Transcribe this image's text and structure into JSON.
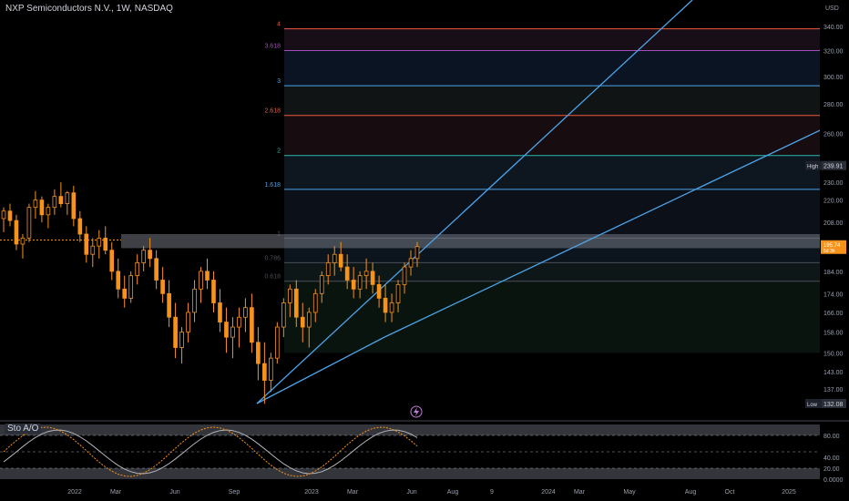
{
  "header": {
    "title": "NXP Semiconductors N.V., 1W, NASDAQ"
  },
  "currency": "USD",
  "indicator_label": "Sto A/O",
  "price_badges": {
    "high": {
      "label": "High",
      "value": "239.91"
    },
    "low": {
      "label": "Low",
      "value": "132.08"
    },
    "last": {
      "value": "195.74",
      "sub": "5d 3h"
    }
  },
  "colors": {
    "candle": "#f7931a",
    "trendline": "#4da3e8",
    "fib_0": "#4a4e59",
    "fib_1618": "#4da3e8",
    "fib_2": "#2bbcb0",
    "fib_2618": "#f05a3c",
    "fib_3": "#4da3e8",
    "fib_3618": "#a64dbf",
    "fib_4": "#f05a3c"
  },
  "chart_data": {
    "type": "candlestick",
    "timeframe": "1W",
    "y_axis_ticks": [
      "340.00",
      "320.00",
      "300.00",
      "280.00",
      "260.00",
      "240.00",
      "230.00",
      "220.00",
      "208.00",
      "196.00",
      "184.00",
      "174.00",
      "166.00",
      "158.00",
      "150.00",
      "143.00",
      "137.00"
    ],
    "y_axis_scale": "log",
    "x_axis_ticks": [
      "2022",
      "Mar",
      "Jun",
      "Sep",
      "2023",
      "Mar",
      "Jun",
      "Aug",
      "9",
      "2024",
      "Mar",
      "May",
      "Aug",
      "Oct",
      "2025"
    ],
    "fib_levels": [
      {
        "label": "0.618",
        "price": 179.5
      },
      {
        "label": "0.786",
        "price": 188
      },
      {
        "label": "1",
        "price": 200
      },
      {
        "label": "1.618",
        "price": 226
      },
      {
        "label": "2",
        "price": 246
      },
      {
        "label": "2.618",
        "price": 272
      },
      {
        "label": "3",
        "price": 293
      },
      {
        "label": "3.618",
        "price": 320
      },
      {
        "label": "4",
        "price": 338
      }
    ],
    "candles": [
      [
        210,
        216,
        203,
        214
      ],
      [
        214,
        218,
        206,
        209
      ],
      [
        209,
        212,
        194,
        197
      ],
      [
        197,
        202,
        190,
        200
      ],
      [
        200,
        218,
        198,
        216
      ],
      [
        216,
        225,
        210,
        220
      ],
      [
        220,
        222,
        208,
        212
      ],
      [
        212,
        218,
        205,
        216
      ],
      [
        216,
        226,
        212,
        222
      ],
      [
        222,
        230,
        216,
        218
      ],
      [
        218,
        225,
        212,
        224
      ],
      [
        224,
        228,
        206,
        210
      ],
      [
        210,
        214,
        198,
        202
      ],
      [
        202,
        206,
        188,
        192
      ],
      [
        192,
        200,
        186,
        196
      ],
      [
        196,
        204,
        190,
        200
      ],
      [
        200,
        206,
        192,
        194
      ],
      [
        194,
        198,
        180,
        184
      ],
      [
        184,
        190,
        172,
        176
      ],
      [
        176,
        182,
        168,
        172
      ],
      [
        172,
        184,
        170,
        182
      ],
      [
        182,
        192,
        178,
        188
      ],
      [
        188,
        196,
        184,
        194
      ],
      [
        194,
        200,
        186,
        190
      ],
      [
        190,
        194,
        176,
        180
      ],
      [
        180,
        186,
        170,
        174
      ],
      [
        174,
        180,
        160,
        164
      ],
      [
        164,
        170,
        148,
        152
      ],
      [
        152,
        160,
        146,
        158
      ],
      [
        158,
        170,
        154,
        166
      ],
      [
        166,
        180,
        162,
        176
      ],
      [
        176,
        186,
        170,
        184
      ],
      [
        184,
        190,
        176,
        180
      ],
      [
        180,
        184,
        166,
        170
      ],
      [
        170,
        176,
        158,
        162
      ],
      [
        162,
        168,
        150,
        156
      ],
      [
        156,
        164,
        148,
        160
      ],
      [
        160,
        168,
        152,
        164
      ],
      [
        164,
        172,
        158,
        168
      ],
      [
        168,
        174,
        150,
        154
      ],
      [
        154,
        160,
        140,
        146
      ],
      [
        146,
        154,
        132,
        140
      ],
      [
        140,
        150,
        136,
        148
      ],
      [
        148,
        162,
        146,
        160
      ],
      [
        160,
        172,
        156,
        170
      ],
      [
        170,
        178,
        164,
        176
      ],
      [
        176,
        180,
        160,
        164
      ],
      [
        164,
        170,
        154,
        160
      ],
      [
        160,
        168,
        152,
        166
      ],
      [
        166,
        176,
        162,
        174
      ],
      [
        174,
        184,
        170,
        182
      ],
      [
        182,
        192,
        178,
        188
      ],
      [
        188,
        196,
        182,
        192
      ],
      [
        192,
        198,
        184,
        186
      ],
      [
        186,
        192,
        176,
        180
      ],
      [
        180,
        186,
        172,
        176
      ],
      [
        176,
        184,
        172,
        182
      ],
      [
        182,
        190,
        176,
        184
      ],
      [
        184,
        188,
        174,
        178
      ],
      [
        178,
        182,
        168,
        172
      ],
      [
        172,
        178,
        162,
        166
      ],
      [
        166,
        174,
        162,
        170
      ],
      [
        170,
        180,
        166,
        178
      ],
      [
        178,
        188,
        174,
        186
      ],
      [
        186,
        194,
        182,
        190
      ],
      [
        190,
        198,
        186,
        195.74
      ]
    ],
    "trendlines": [
      {
        "from": [
          "2022-Oct",
          132.08
        ],
        "to": [
          "2024-Jun",
          340
        ]
      },
      {
        "from": [
          "2023-May",
          156
        ],
        "to": [
          "2025-Mar",
          262
        ]
      }
    ],
    "indicator": {
      "name": "Sto A/O",
      "y_axis_ticks": [
        "80.00",
        "40.00",
        "20.00",
        "0.0000"
      ],
      "bands": [
        [
          80,
          100
        ],
        [
          0,
          20
        ]
      ]
    }
  }
}
